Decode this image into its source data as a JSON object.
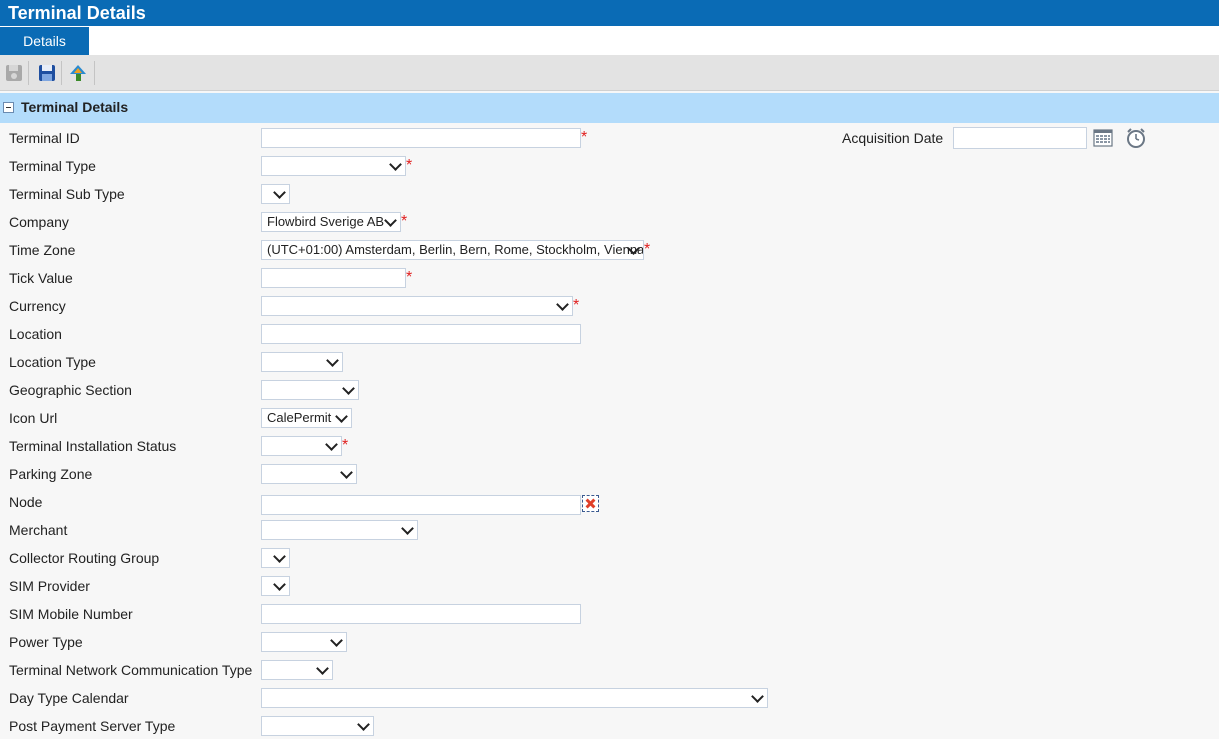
{
  "header": {
    "title": "Terminal Details"
  },
  "tabs": [
    {
      "label": "Details",
      "active": true
    }
  ],
  "toolbar": {
    "buttons": [
      {
        "icon": "save-disabled-icon"
      },
      {
        "icon": "save-icon"
      },
      {
        "icon": "upload-icon"
      }
    ]
  },
  "section": {
    "title": "Terminal Details"
  },
  "fields": {
    "terminal_id": {
      "label": "Terminal ID",
      "value": ""
    },
    "terminal_type": {
      "label": "Terminal Type",
      "value": ""
    },
    "terminal_sub_type": {
      "label": "Terminal Sub Type",
      "value": ""
    },
    "company": {
      "label": "Company",
      "value": "Flowbird Sverige AB"
    },
    "time_zone": {
      "label": "Time Zone",
      "value": "(UTC+01:00) Amsterdam, Berlin, Bern, Rome, Stockholm, Vienna"
    },
    "tick_value": {
      "label": "Tick Value",
      "value": ""
    },
    "currency": {
      "label": "Currency",
      "value": ""
    },
    "location": {
      "label": "Location",
      "value": ""
    },
    "location_type": {
      "label": "Location Type",
      "value": ""
    },
    "geographic_section": {
      "label": "Geographic Section",
      "value": ""
    },
    "icon_url": {
      "label": "Icon Url",
      "value": "CalePermit"
    },
    "installation_status": {
      "label": "Terminal Installation Status",
      "value": ""
    },
    "parking_zone": {
      "label": "Parking Zone",
      "value": ""
    },
    "node": {
      "label": "Node",
      "value": ""
    },
    "merchant": {
      "label": "Merchant",
      "value": ""
    },
    "collector_routing_group": {
      "label": "Collector Routing Group",
      "value": ""
    },
    "sim_provider": {
      "label": "SIM Provider",
      "value": ""
    },
    "sim_mobile_number": {
      "label": "SIM Mobile Number",
      "value": ""
    },
    "power_type": {
      "label": "Power Type",
      "value": ""
    },
    "network_comm_type": {
      "label": "Terminal Network Communication Type",
      "value": ""
    },
    "day_type_calendar": {
      "label": "Day Type Calendar",
      "value": ""
    },
    "post_payment_server_type": {
      "label": "Post Payment Server Type",
      "value": ""
    },
    "acquisition_date": {
      "label": "Acquisition Date",
      "value": ""
    }
  },
  "required_marker": "*"
}
